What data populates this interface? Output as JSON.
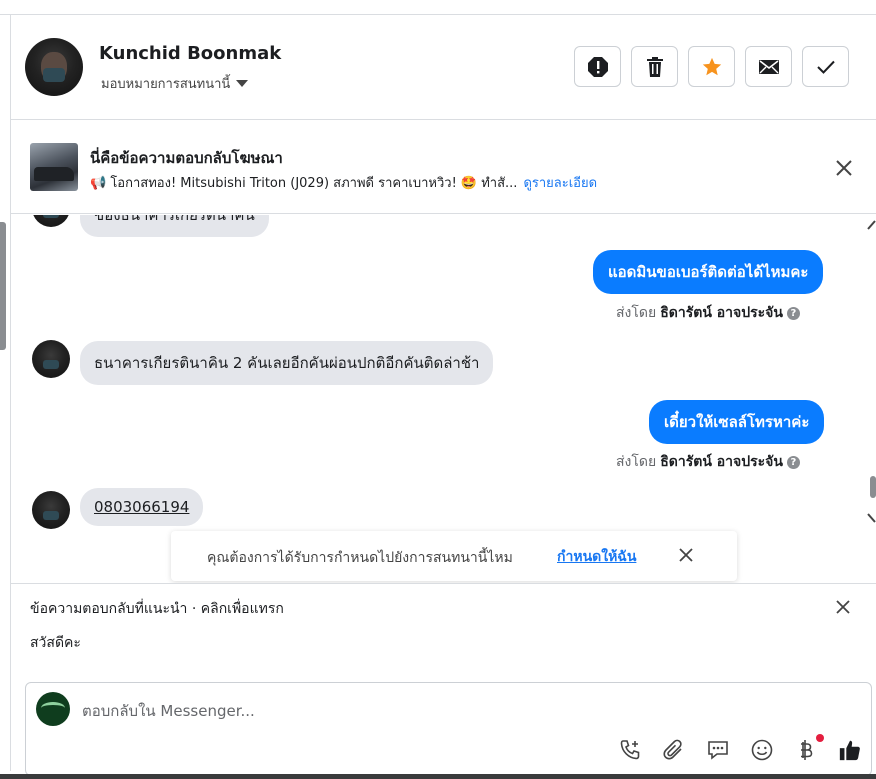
{
  "contact": {
    "name": "Kunchid Boonmak",
    "assign_label": "มอบหมายการสนทนานี้"
  },
  "header_actions": [
    {
      "name": "spam-icon"
    },
    {
      "name": "trash-icon"
    },
    {
      "name": "star-icon"
    },
    {
      "name": "envelope-icon"
    },
    {
      "name": "check-icon"
    }
  ],
  "ad_reply": {
    "title": "นี่คือข้อความตอบกลับโฆษณา",
    "snippet": "📢 โอกาสทอง! Mitsubishi Triton (J029) สภาพดี ราคาเบาหวิว! 🤩 ทำสั...",
    "details_link": "ดูรายละเอียด"
  },
  "messages": {
    "partial_top": "ของธนาคารเกียรตินาคิน",
    "out_1": "แอดมินขอเบอร์ติดต่อได้ไหมคะ",
    "sent_by_prefix": "ส่งโดย",
    "sent_by_name": "ธิดารัตน์ อาจประจัน",
    "in_2": "ธนาคารเกียรตินาคิน 2 คันเลยอีกคันผ่อนปกติอีกคันติดล่าช้า",
    "out_2": "เดี๋ยวให้เซลล์โทรหาค่ะ",
    "in_3": "0803066194"
  },
  "assign_prompt": {
    "question": "คุณต้องการได้รับการกำหนดไปยังการสนทนานี้ไหม",
    "action": "กำหนดให้ฉัน"
  },
  "suggestions": {
    "title": "ข้อความตอบกลับที่แนะนำ · คลิกเพื่อแทรก",
    "items": [
      "สวัสดีคะ"
    ]
  },
  "composer": {
    "placeholder": "ตอบกลับใน Messenger..."
  },
  "colors": {
    "accent": "#1877f2",
    "outgoing_bubble": "#0a7cff",
    "incoming_bubble": "#e4e6eb",
    "star": "#f7931e",
    "notification_dot": "#e41e3f"
  }
}
